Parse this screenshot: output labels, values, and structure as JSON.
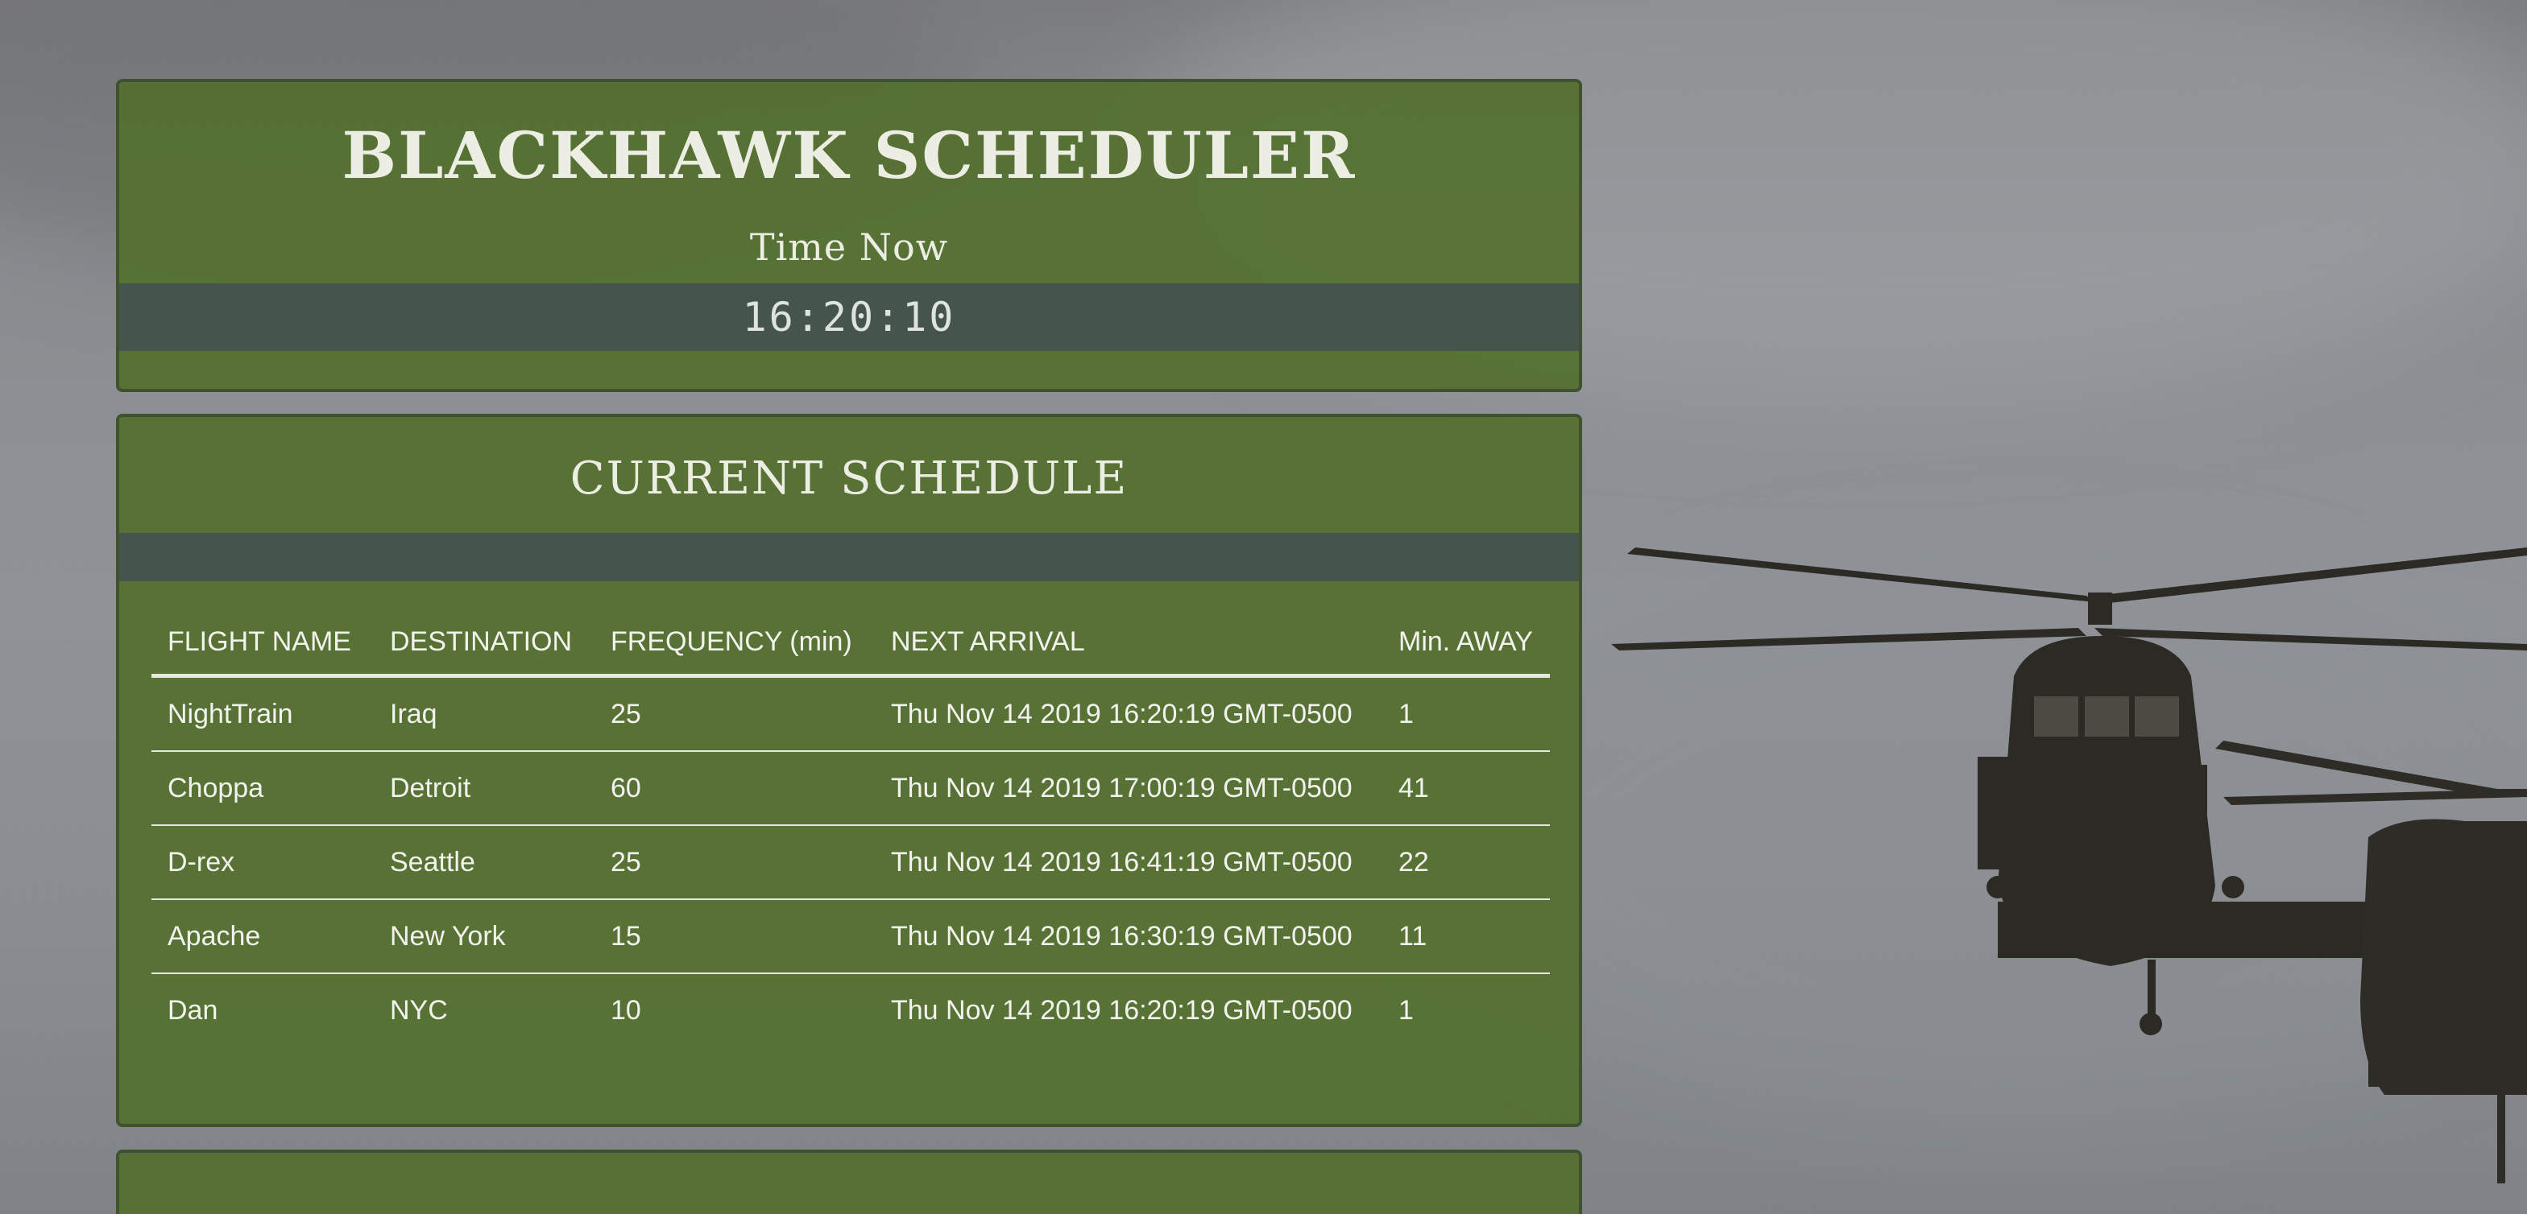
{
  "header": {
    "title": "BLACKHAWK SCHEDULER",
    "time_label": "Time Now",
    "clock": "16:20:10"
  },
  "schedule": {
    "title": "CURRENT SCHEDULE",
    "columns": [
      "FLIGHT NAME",
      "DESTINATION",
      "FREQUENCY (min)",
      "NEXT ARRIVAL",
      "Min. AWAY"
    ],
    "rows": [
      [
        "NightTrain",
        "Iraq",
        "25",
        "Thu Nov 14 2019 16:20:19 GMT-0500",
        "1"
      ],
      [
        "Choppa",
        "Detroit",
        "60",
        "Thu Nov 14 2019 17:00:19 GMT-0500",
        "41"
      ],
      [
        "D-rex",
        "Seattle",
        "25",
        "Thu Nov 14 2019 16:41:19 GMT-0500",
        "22"
      ],
      [
        "Apache",
        "New York",
        "15",
        "Thu Nov 14 2019 16:30:19 GMT-0500",
        "11"
      ],
      [
        "Dan",
        "NYC",
        "10",
        "Thu Nov 14 2019 16:20:19 GMT-0500",
        "1"
      ]
    ]
  },
  "colors": {
    "panel": "#54702e",
    "panel_border": "#3f5130",
    "bar": "#45554e",
    "text": "#eceee4"
  }
}
